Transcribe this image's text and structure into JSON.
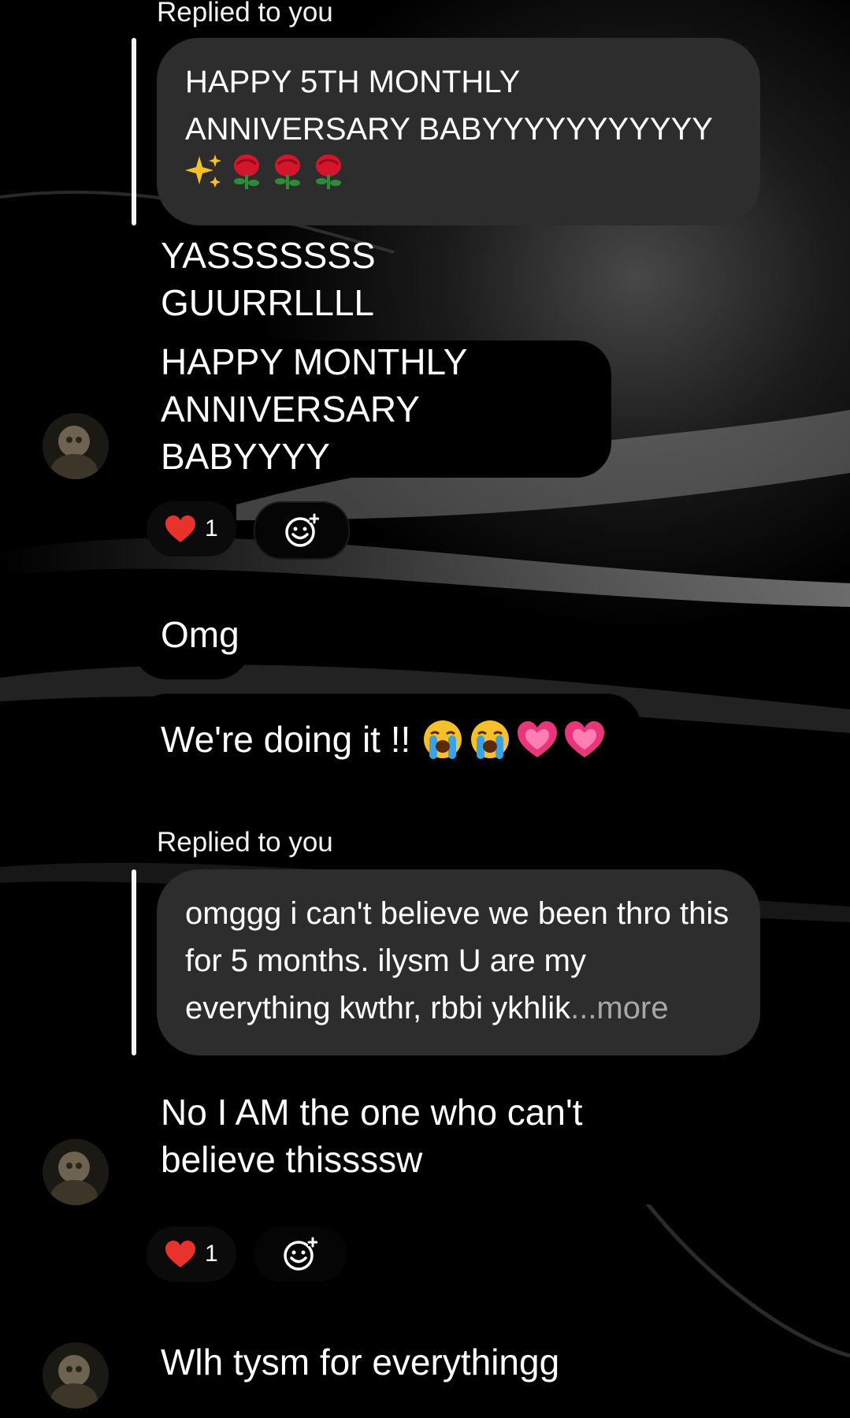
{
  "thread": {
    "reply_1": {
      "label": "Replied to you",
      "quoted_text": "HAPPY 5TH MONTHLY ANNIVERSARY BABYYYYYYYYYYY",
      "quoted_emojis": [
        "sparkles",
        "rose",
        "rose",
        "rose"
      ]
    },
    "msg_yass": "YASSSSSSS GUURRLLLL",
    "msg_happy": "HAPPY MONTHLY\nANNIVERSARY BABYYYY",
    "reaction_1": {
      "emoji": "red-heart",
      "count": "1"
    },
    "msg_omg": "Omg",
    "msg_doing": "We're doing it !!",
    "msg_doing_emojis": [
      "loudly-crying-face",
      "loudly-crying-face",
      "growing-heart",
      "growing-heart"
    ],
    "reply_2": {
      "label": "Replied to you",
      "quoted_text": "omggg i can't believe we been thro this for 5 months. ilysm U are my everything kwthr, rbbi ykhlik",
      "more_label": "...more"
    },
    "msg_believe": "No I AM the one who can't\nbelieve thissssw",
    "reaction_2": {
      "emoji": "red-heart",
      "count": "1"
    },
    "msg_tysm": "Wlh tysm for everythingg"
  },
  "colors": {
    "page_bg": "#000000",
    "quote_bubble": "#2d2d2d",
    "message_bubble": "#000000",
    "more_link": "#a8a8a8",
    "heart": "#e8332d"
  }
}
